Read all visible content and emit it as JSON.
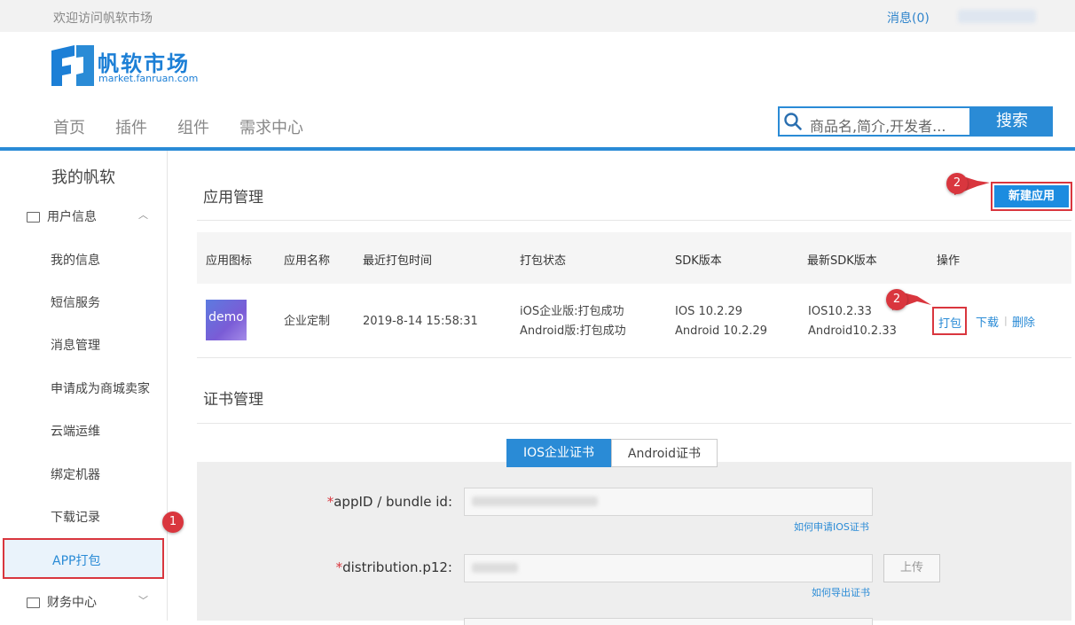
{
  "topbar": {
    "welcome": "欢迎访问帆软市场",
    "messages": "消息(0)"
  },
  "logo": {
    "title": "帆软市场",
    "subtitle": "market.fanruan.com"
  },
  "nav": [
    "首页",
    "插件",
    "组件",
    "需求中心"
  ],
  "search": {
    "placeholder": "商品名,简介,开发者...",
    "button": "搜索"
  },
  "sidebar": {
    "title": "我的帆软",
    "group_user": "用户信息",
    "items": [
      "我的信息",
      "短信服务",
      "消息管理",
      "申请成为商城卖家",
      "云端运维",
      "绑定机器",
      "下载记录",
      "APP打包"
    ],
    "group_finance": "财务中心"
  },
  "app_mgmt": {
    "title": "应用管理",
    "new_button": "新建应用",
    "columns": [
      "应用图标",
      "应用名称",
      "最近打包时间",
      "打包状态",
      "SDK版本",
      "最新SDK版本",
      "操作"
    ],
    "row": {
      "icon_text": "demo",
      "name": "企业定制",
      "time": "2019-8-14 15:58:31",
      "status_ios": "iOS企业版:打包成功",
      "status_android": "Android版:打包成功",
      "sdk_ios": "IOS 10.2.29",
      "sdk_android": "Android 10.2.29",
      "latest_ios": "IOS10.2.33",
      "latest_android": "Android10.2.33",
      "action_pack": "打包",
      "action_download": "下载",
      "action_delete": "删除"
    }
  },
  "cert_mgmt": {
    "title": "证书管理",
    "tab_ios": "IOS企业证书",
    "tab_android": "Android证书",
    "field_appid": "appID / bundle id:",
    "help_appid": "如何申请IOS证书",
    "field_p12": "distribution.p12:",
    "upload": "上传",
    "help_p12": "如何导出证书"
  },
  "annotations": {
    "step1": "1",
    "step2": "2"
  },
  "colors": {
    "brand": "#2a8bd6",
    "highlight": "#d9363e"
  },
  "icons": [
    "search-icon",
    "folder-icon",
    "chevron-up-icon",
    "chevron-down-icon",
    "fanruan-logo"
  ]
}
